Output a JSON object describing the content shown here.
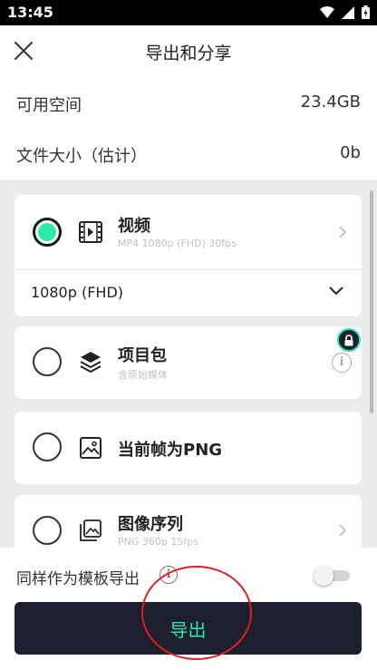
{
  "status_bar": {
    "time": "13:45"
  },
  "header": {
    "title": "导出和分享"
  },
  "storage": {
    "available_label": "可用空间",
    "available_value": "23.4GB",
    "size_label": "文件大小（估计）",
    "size_value": "0b"
  },
  "options": {
    "video": {
      "title": "视频",
      "subtitle": "MP4 1080p (FHD) 30fps",
      "selected": true,
      "resolution": "1080p (FHD)"
    },
    "project": {
      "title": "项目包",
      "subtitle": "含原始媒体"
    },
    "frame": {
      "title": "当前帧为PNG"
    },
    "sequence": {
      "title": "图像序列",
      "subtitle": "PNG 360p 15fps"
    }
  },
  "footer": {
    "template_label": "同样作为模板导出",
    "template_toggle_on": false,
    "export_label": "导出"
  },
  "colors": {
    "accent": "#2ee8a8",
    "dark": "#1e1f2e",
    "annotation": "#e02020"
  }
}
